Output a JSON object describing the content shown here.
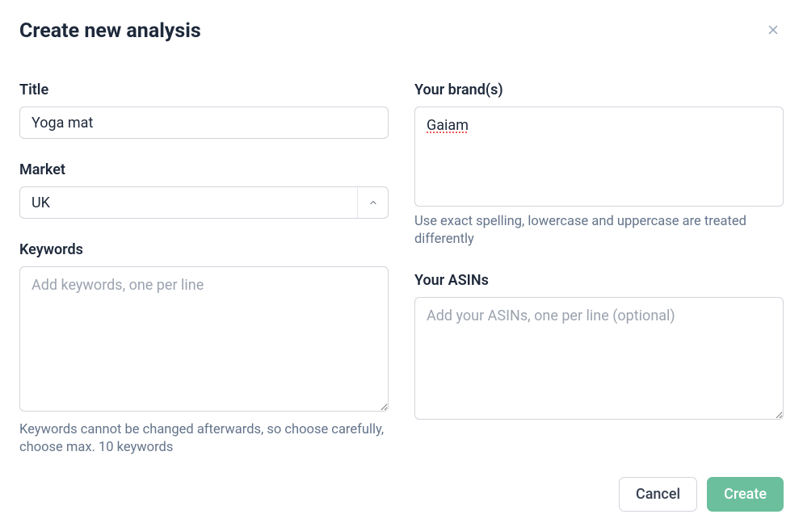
{
  "modal": {
    "title": "Create new analysis"
  },
  "form": {
    "title_label": "Title",
    "title_value": "Yoga mat",
    "market_label": "Market",
    "market_value": "UK",
    "keywords_label": "Keywords",
    "keywords_placeholder": "Add keywords, one per line",
    "keywords_helper": "Keywords cannot be changed afterwards, so choose carefully, choose max. 10 keywords",
    "brands_label": "Your brand(s)",
    "brands_value": "Gaiam",
    "brands_helper": "Use exact spelling, lowercase and uppercase are treated differently",
    "asins_label": "Your ASINs",
    "asins_placeholder": "Add your ASINs, one per line (optional)"
  },
  "buttons": {
    "cancel": "Cancel",
    "create": "Create"
  }
}
